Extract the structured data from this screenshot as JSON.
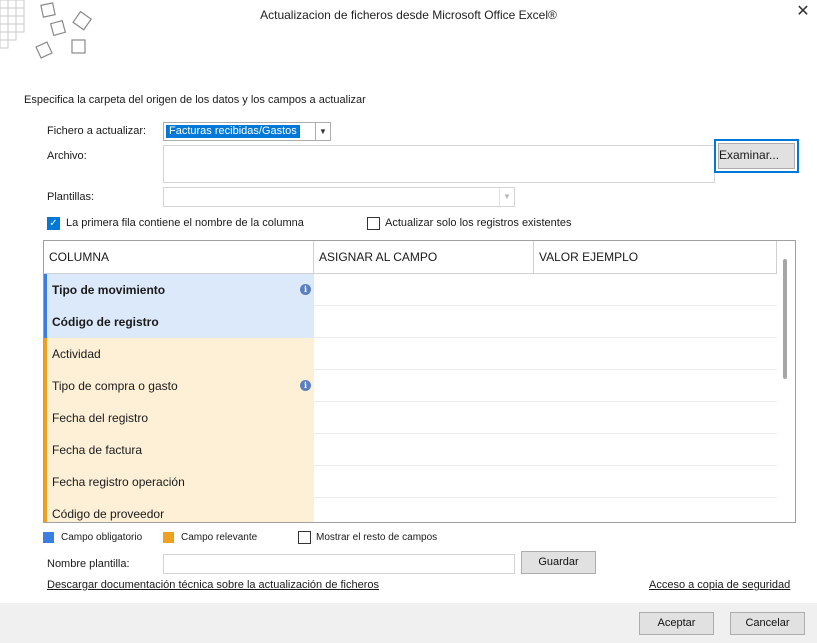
{
  "window": {
    "title": "Actualizacion de ficheros desde Microsoft Office Excel®",
    "close_glyph": "✕"
  },
  "intro": "Especifica la carpeta del origen de los datos y los campos a actualizar",
  "form": {
    "fichero_label": "Fichero a actualizar:",
    "fichero_value": "Facturas recibidas/Gastos",
    "archivo_label": "Archivo:",
    "archivo_value": "",
    "examinar_label": "Examinar...",
    "plantillas_label": "Plantillas:",
    "plantillas_value": "",
    "first_row_label": "La primera fila contiene el nombre de la columna",
    "first_row_checked": true,
    "only_existing_label": "Actualizar solo los registros existentes",
    "only_existing_checked": false
  },
  "grid": {
    "headers": [
      "COLUMNA",
      "ASIGNAR AL CAMPO",
      "VALOR EJEMPLO"
    ],
    "rows": [
      {
        "columna": "Tipo de movimiento",
        "kind": "obligatorio",
        "info": true
      },
      {
        "columna": "Código de registro",
        "kind": "obligatorio",
        "info": false
      },
      {
        "columna": "Actividad",
        "kind": "relevante",
        "info": false
      },
      {
        "columna": "Tipo de compra o gasto",
        "kind": "relevante",
        "info": true
      },
      {
        "columna": "Fecha del registro",
        "kind": "relevante",
        "info": false
      },
      {
        "columna": "Fecha de factura",
        "kind": "relevante",
        "info": false
      },
      {
        "columna": "Fecha registro operación",
        "kind": "relevante",
        "info": false
      },
      {
        "columna": "Código de proveedor",
        "kind": "relevante",
        "info": false
      }
    ],
    "info_glyph": "i"
  },
  "legend": {
    "obligatorio_label": "Campo obligatorio",
    "obligatorio_color": "#3a7ee4",
    "relevante_label": "Campo relevante",
    "relevante_color": "#f0a020",
    "mostrar_label": "Mostrar el resto de campos",
    "mostrar_checked": false
  },
  "template": {
    "nombre_label": "Nombre plantilla:",
    "nombre_value": "",
    "guardar_label": "Guardar"
  },
  "links": {
    "doc": "Descargar documentación técnica sobre la actualización de ficheros",
    "backup": "Acceso a copia de seguridad"
  },
  "footer": {
    "aceptar_label": "Aceptar",
    "cancelar_label": "Cancelar"
  },
  "icons": {
    "logo": "tiles-logo-icon",
    "close": "close-icon",
    "dropdown": "chevron-down-icon",
    "check": "checkmark-icon",
    "info": "info-icon"
  }
}
